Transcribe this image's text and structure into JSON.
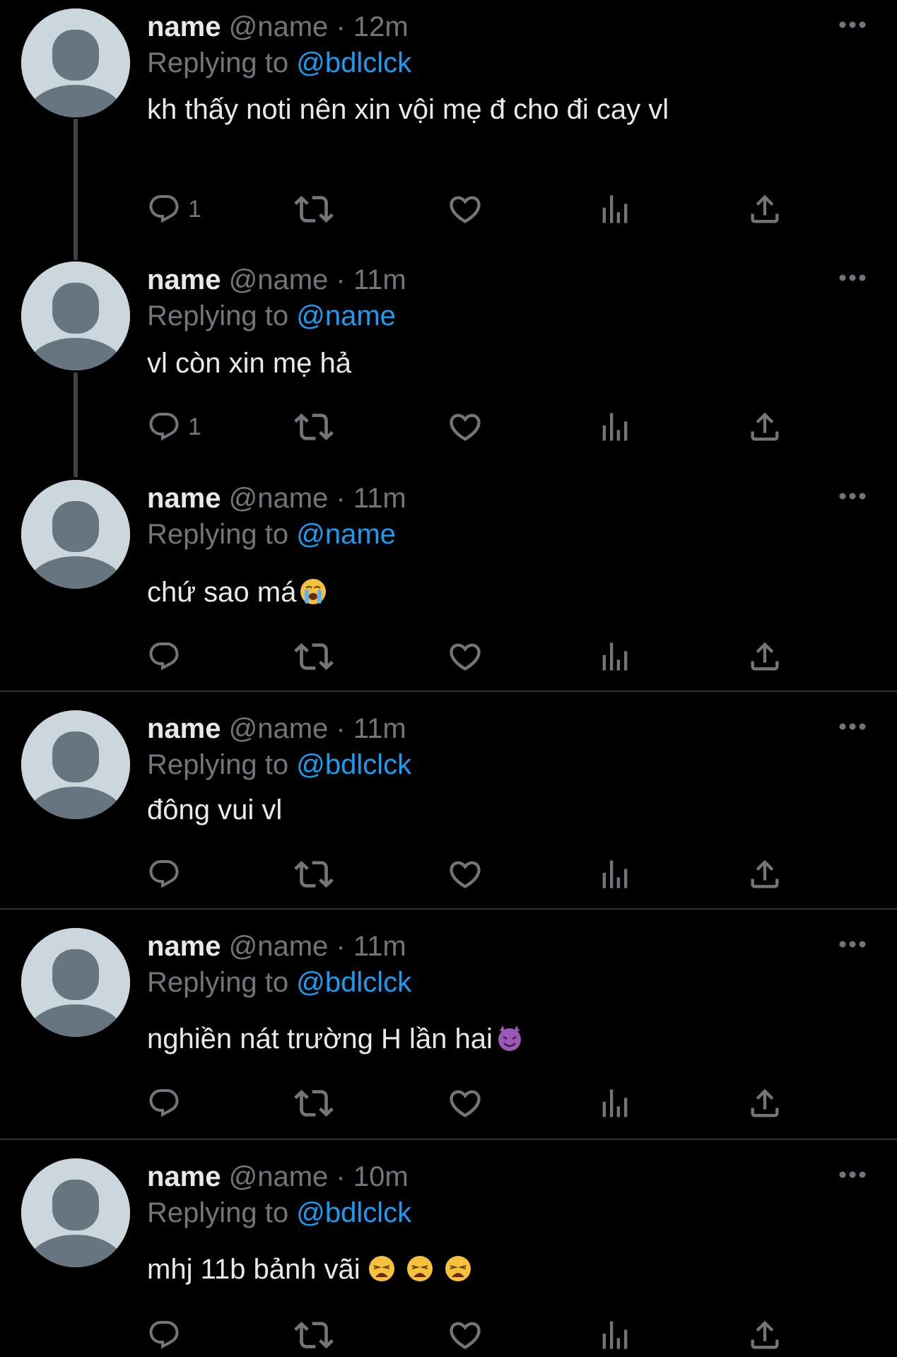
{
  "theme": {
    "background": "#000000",
    "text": "#e7e9ea",
    "muted": "#71767b",
    "link": "#1d9bf0"
  },
  "tweets": [
    {
      "name": "name",
      "handle": "@name",
      "time": "12m",
      "replying_label": "Replying to",
      "replying_to": "@bdlclck",
      "text": "kh thấy noti nên xin vội mẹ đ cho đi cay vl",
      "reply_count": "1"
    },
    {
      "name": "name",
      "handle": "@name",
      "time": "11m",
      "replying_label": "Replying to",
      "replying_to": "@name",
      "text": "vl còn xin mẹ hả",
      "reply_count": "1"
    },
    {
      "name": "name",
      "handle": "@name",
      "time": "11m",
      "replying_label": "Replying to",
      "replying_to": "@name",
      "text": "chứ sao má",
      "emoji": "loudly-crying-face",
      "reply_count": ""
    },
    {
      "name": "name",
      "handle": "@name",
      "time": "11m",
      "replying_label": "Replying to",
      "replying_to": "@bdlclck",
      "text": "đông vui vl",
      "reply_count": ""
    },
    {
      "name": "name",
      "handle": "@name",
      "time": "11m",
      "replying_label": "Replying to",
      "replying_to": "@bdlclck",
      "text": "nghiền nát trường H lần hai",
      "emoji": "smiling-devil",
      "reply_count": ""
    },
    {
      "name": "name",
      "handle": "@name",
      "time": "10m",
      "replying_label": "Replying to",
      "replying_to": "@bdlclck",
      "text": "mhj 11b bảnh vãi",
      "emoji": "weary-face x3",
      "reply_count": ""
    }
  ],
  "separator": "·",
  "icons": [
    "reply-icon",
    "retweet-icon",
    "like-icon",
    "views-icon",
    "share-icon",
    "more-icon"
  ]
}
